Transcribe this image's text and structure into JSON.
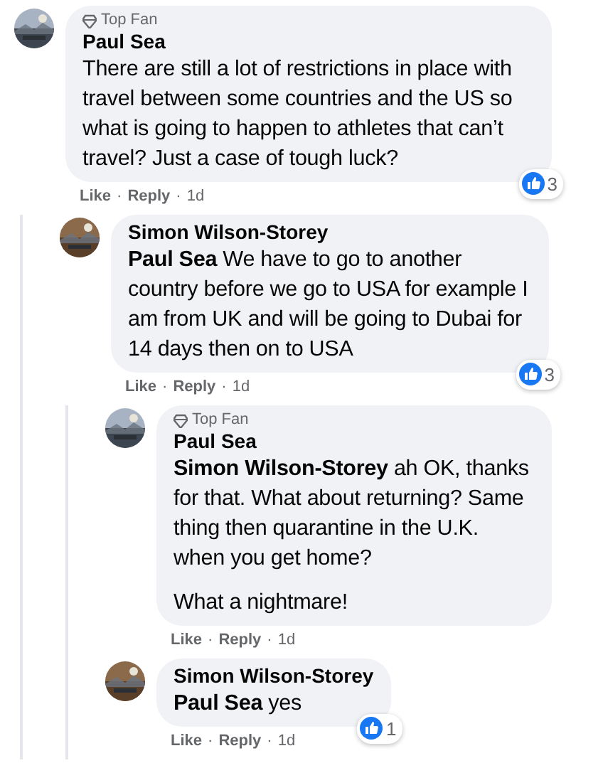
{
  "comments": [
    {
      "avatar": {
        "kind": "picture"
      },
      "badge": {
        "text": "Top Fan"
      },
      "author": "Paul Sea",
      "paragraphs": [
        "There are still a lot of restrictions in place with travel between some countries and the US so what is going to happen to athletes that can’t travel? Just a case of tough luck?"
      ],
      "meta": [
        {
          "kind": "link",
          "text": "Like"
        },
        {
          "kind": "dot",
          "text": "·"
        },
        {
          "kind": "link",
          "text": "Reply"
        },
        {
          "kind": "dot",
          "text": "·"
        },
        {
          "kind": "time",
          "text": "1d"
        }
      ],
      "reactions": "3",
      "children": [
        {
          "avatar": {
            "kind": "picture"
          },
          "author": "Simon Wilson-Storey",
          "paragraphs": [
            "**Paul Sea** We have to go to another country before we go to USA for example I am from UK and will be going to Dubai for 14 days then on to USA"
          ],
          "meta": [
            {
              "kind": "link",
              "text": "Like"
            },
            {
              "kind": "dot",
              "text": "·"
            },
            {
              "kind": "link",
              "text": "Reply"
            },
            {
              "kind": "dot",
              "text": "·"
            },
            {
              "kind": "time",
              "text": "1d"
            }
          ],
          "reactions": "3",
          "children": [
            {
              "avatar": {
                "kind": "picture"
              },
              "badge": {
                "text": "Top Fan"
              },
              "author": "Paul Sea",
              "paragraphs": [
                "**Simon Wilson-Storey** ah OK, thanks for that. What about returning? Same thing then quarantine in the U.K. when you get home?",
                "What a nightmare!"
              ],
              "meta": [
                {
                  "kind": "link",
                  "text": "Like"
                },
                {
                  "kind": "dot",
                  "text": "·"
                },
                {
                  "kind": "link",
                  "text": "Reply"
                },
                {
                  "kind": "dot",
                  "text": "·"
                },
                {
                  "kind": "time",
                  "text": "1d"
                }
              ]
            },
            {
              "avatar": {
                "kind": "picture"
              },
              "author": "Simon Wilson-Storey",
              "paragraphs": [
                "**Paul Sea** yes"
              ],
              "meta": [
                {
                  "kind": "link",
                  "text": "Like"
                },
                {
                  "kind": "dot",
                  "text": "·"
                },
                {
                  "kind": "link",
                  "text": "Reply"
                },
                {
                  "kind": "dot",
                  "text": "·"
                },
                {
                  "kind": "time",
                  "text": "1d"
                }
              ],
              "reactions": "1"
            }
          ]
        }
      ]
    }
  ]
}
